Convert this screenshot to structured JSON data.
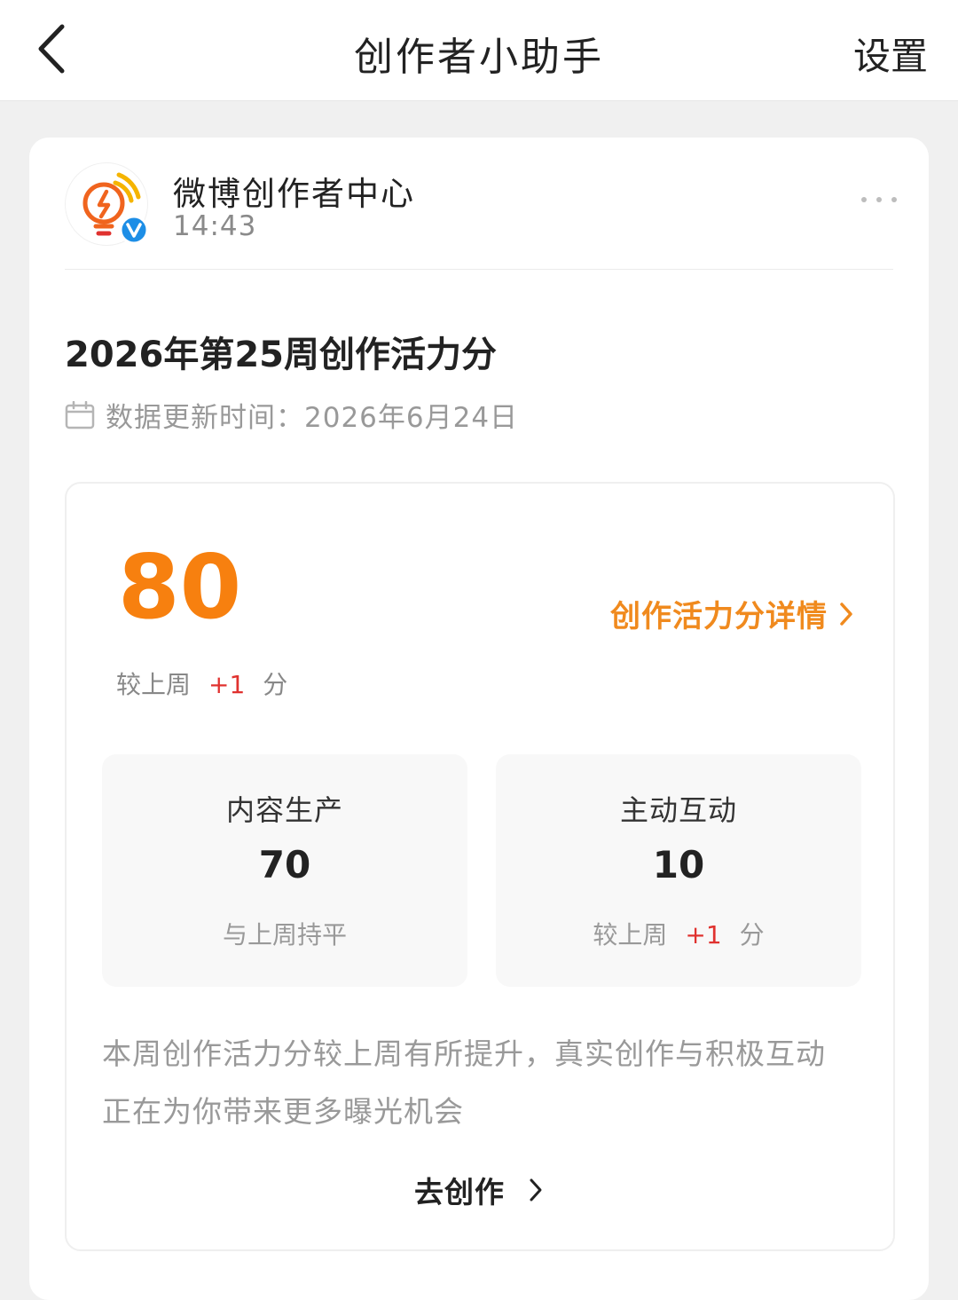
{
  "nav": {
    "back_icon": "chevron-left-icon",
    "title": "创作者小助手",
    "settings_label": "设置"
  },
  "post": {
    "account_name": "微博创作者中心",
    "time": "14:43",
    "avatar_icon": "lightbulb-lightning-icon",
    "verified_icon": "verified-v-icon",
    "more_icon": "more-dots-icon",
    "title": "2026年第25周创作活力分",
    "update_icon": "calendar-icon",
    "update_text": "数据更新时间：2026年6月24日"
  },
  "score": {
    "value": "80",
    "detail_link": "创作活力分详情",
    "change_prefix": "较上周",
    "change_value": "+1",
    "change_unit": "分"
  },
  "metrics": [
    {
      "label": "内容生产",
      "value": "70",
      "sub": "与上周持平"
    },
    {
      "label": "主动互动",
      "value": "10",
      "change_prefix": "较上周",
      "change_value": "+1",
      "change_unit": "分"
    }
  ],
  "summary": {
    "line1": "本周创作活力分较上周有所提升，真实创作与积极互动",
    "line2": "正在为你带来更多曝光机会"
  },
  "cta": {
    "label": "去创作"
  },
  "colors": {
    "accent_orange": "#f7800f",
    "link_orange": "#f08a1e",
    "increase_red": "#e0322f",
    "verified_blue": "#1d8ee6"
  }
}
